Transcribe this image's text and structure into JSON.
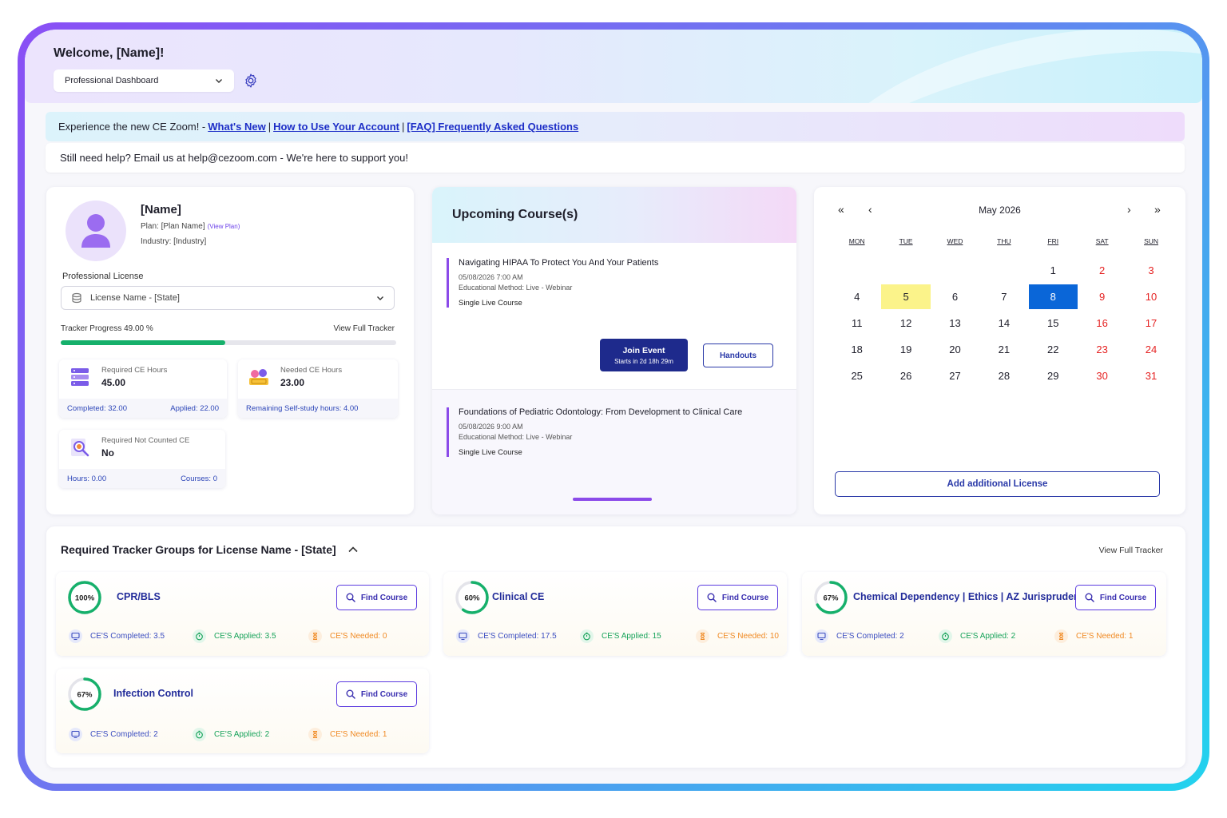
{
  "header": {
    "welcome": "Welcome, [Name]!",
    "dashboard_select": "Professional Dashboard"
  },
  "notice": {
    "intro": "Experience the new CE Zoom! -",
    "link_whats_new": "What's New",
    "sep1": "|",
    "link_how_to": "How to Use Your Account",
    "sep2": "|",
    "link_faq": "[FAQ] Frequently Asked Questions"
  },
  "help": {
    "text": "Still need help? Email us at help@cezoom.com - We're here to support you!"
  },
  "profile": {
    "name": "[Name]",
    "plan": "Plan: [Plan Name]",
    "view_plan": "(View Plan)",
    "industry": "Industry: [Industry]",
    "license_label": "Professional License",
    "license_select": "License Name - [State]",
    "tracker_label": "Tracker Progress 49.00 %",
    "tracker_progress_pct": 49,
    "view_full_tracker": "View Full Tracker",
    "stats": [
      {
        "label": "Required CE Hours",
        "value": "45.00",
        "foot_left": "Completed: 32.00",
        "foot_right": "Applied: 22.00",
        "icon": "server-icon"
      },
      {
        "label": "Needed CE Hours",
        "value": "23.00",
        "foot_left": "Remaining Self-study hours: 4.00",
        "foot_right": "",
        "icon": "ticket-icon"
      },
      {
        "label": "Required Not Counted CE",
        "value": "No",
        "foot_left": "Hours: 0.00",
        "foot_right": "Courses: 0",
        "icon": "magnifier-icon"
      }
    ]
  },
  "upcoming": {
    "title": "Upcoming Course(s)",
    "courses": [
      {
        "title": "Navigating HIPAA To Protect You And Your Patients",
        "datetime": "05/08/2026 7:00 AM",
        "method": "Educational Method: Live - Webinar",
        "type": "Single Live Course"
      },
      {
        "title": "Foundations of Pediatric Odontology: From Development to Clinical Care",
        "datetime": "05/08/2026 9:00 AM",
        "method": "Educational Method: Live - Webinar",
        "type": "Single Live Course"
      }
    ],
    "join_label": "Join Event",
    "join_sub": "Starts in 2d 18h 29m",
    "handouts_label": "Handouts"
  },
  "calendar": {
    "nav_first": "«",
    "nav_prev": "‹",
    "nav_next": "›",
    "nav_last": "»",
    "month": "May 2026",
    "weekdays": [
      "MON",
      "TUE",
      "WED",
      "THU",
      "FRI",
      "SAT",
      "SUN"
    ],
    "weeks": [
      [
        "",
        "",
        "",
        "",
        "1",
        "2",
        "3"
      ],
      [
        "4",
        "5",
        "6",
        "7",
        "8",
        "9",
        "10"
      ],
      [
        "11",
        "12",
        "13",
        "14",
        "15",
        "16",
        "17"
      ],
      [
        "18",
        "19",
        "20",
        "21",
        "22",
        "23",
        "24"
      ],
      [
        "25",
        "26",
        "27",
        "28",
        "29",
        "30",
        "31"
      ]
    ],
    "today": "5",
    "selected": "8",
    "add_license": "Add additional License",
    "colors": {
      "weekend": "#e52222",
      "today": "#fbf38a",
      "selected": "#0a66d8"
    }
  },
  "groups": {
    "title": "Required Tracker Groups for License Name - [State]",
    "view_full": "View Full Tracker",
    "find_label": "Find Course",
    "items": [
      {
        "name": "CPR/BLS",
        "percent_label": "100%",
        "percent": 100,
        "completed": "CE'S Completed: 3.5",
        "applied": "CE'S Applied: 3.5",
        "needed": "CE'S Needed: 0"
      },
      {
        "name": "Clinical CE",
        "percent_label": "60%",
        "percent": 60,
        "completed": "CE'S Completed: 17.5",
        "applied": "CE'S Applied: 15",
        "needed": "CE'S Needed: 10"
      },
      {
        "name": "Chemical Dependency | Ethics | AZ Jurisprudence",
        "percent_label": "67%",
        "percent": 67,
        "completed": "CE'S Completed: 2",
        "applied": "CE'S Applied: 2",
        "needed": "CE'S Needed: 1"
      },
      {
        "name": "Infection Control",
        "percent_label": "67%",
        "percent": 67,
        "completed": "CE'S Completed: 2",
        "applied": "CE'S Applied: 2",
        "needed": "CE'S Needed: 1"
      }
    ]
  }
}
